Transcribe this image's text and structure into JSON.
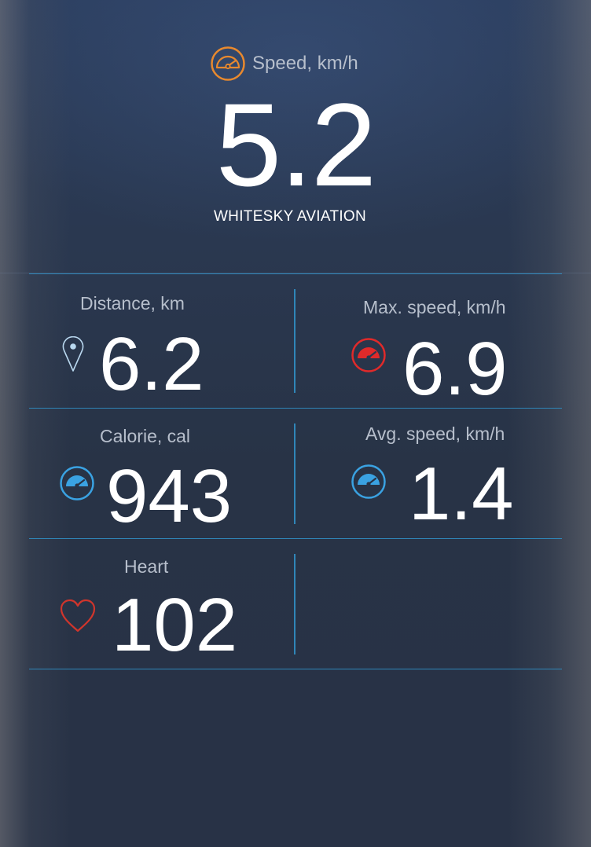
{
  "hero": {
    "label": "Speed, km/h",
    "value": "5.2",
    "subtitle": "WHITESKY AVIATION",
    "icon": "speedometer-icon",
    "icon_color": "#e8892e"
  },
  "metrics": [
    {
      "label": "Distance, km",
      "value": "6.2",
      "icon": "map-pin-icon",
      "icon_color": "#b9d8ef"
    },
    {
      "label": "Max. speed, km/h",
      "value": "6.9",
      "icon": "speedometer-icon",
      "icon_color": "#e02a2a"
    },
    {
      "label": "Calorie, cal",
      "value": "943",
      "icon": "speedometer-icon",
      "icon_color": "#3aa2e2"
    },
    {
      "label": "Avg. speed, km/h",
      "value": "1.4",
      "icon": "speedometer-icon",
      "icon_color": "#3aa2e2"
    },
    {
      "label": "Heart",
      "value": "102",
      "icon": "heart-icon",
      "icon_color": "#d0352c"
    }
  ],
  "colors": {
    "divider": "#2f86b8",
    "label_text": "#b7bfcc",
    "value_text": "#ffffff"
  }
}
